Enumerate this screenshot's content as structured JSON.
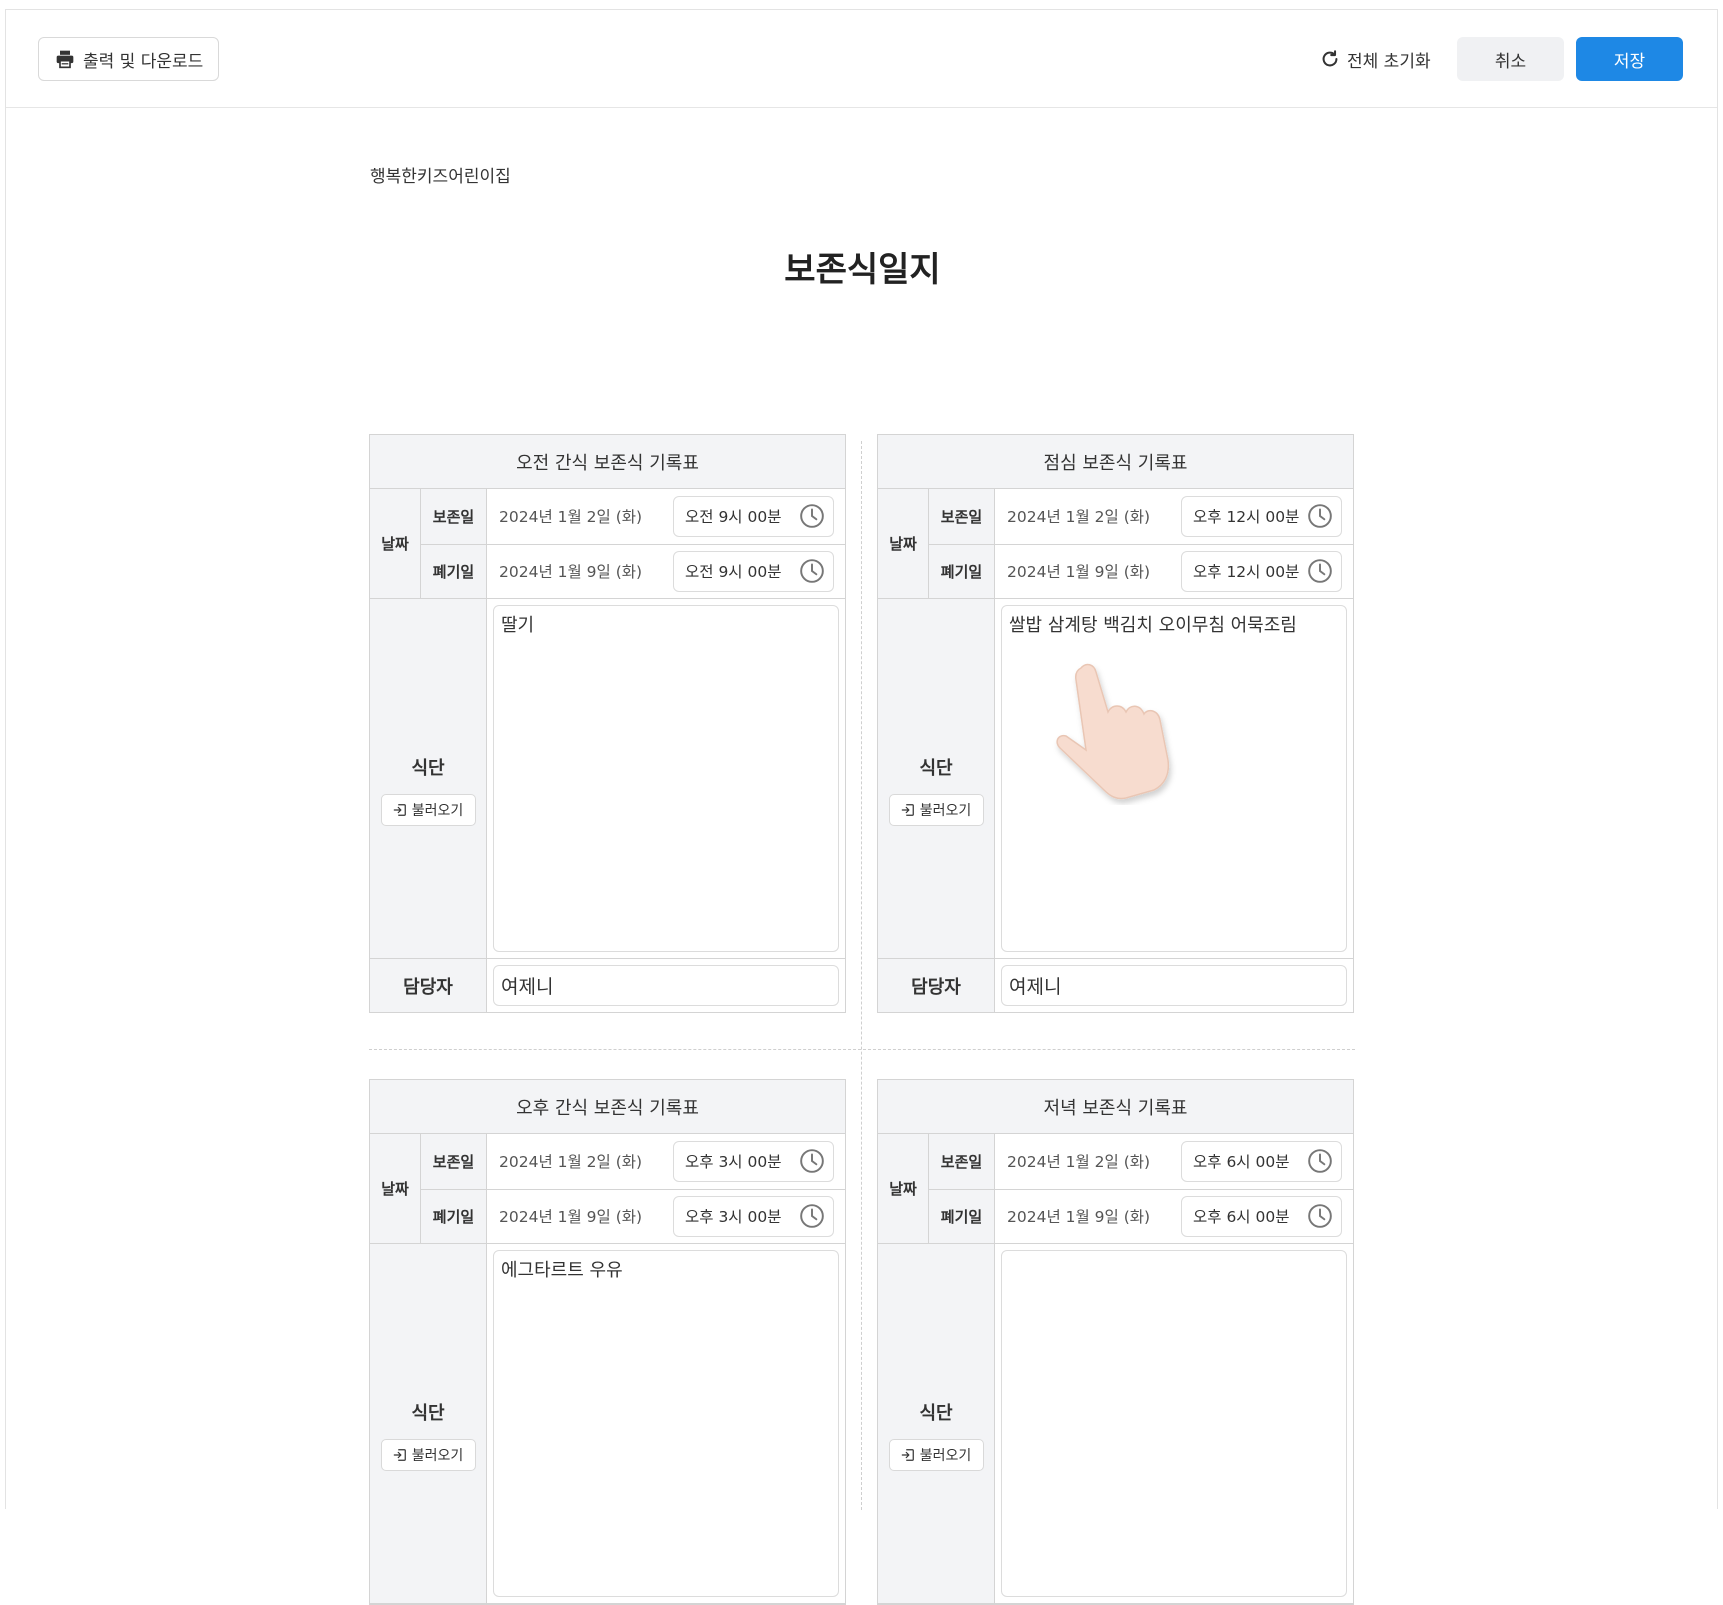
{
  "toolbar": {
    "print_label": "출력 및 다운로드",
    "reset_label": "전체 초기화",
    "cancel_label": "취소",
    "save_label": "저장"
  },
  "document": {
    "org_name": "행복한키즈어린이집",
    "title": "보존식일지"
  },
  "labels": {
    "date": "날짜",
    "keep_day": "보존일",
    "discard_day": "폐기일",
    "menu": "식단",
    "load": "불러오기",
    "staff": "담당자"
  },
  "cards": [
    {
      "title": "오전 간식 보존식 기록표",
      "keep_date": "2024년 1월 2일 (화)",
      "keep_time": "오전 9시 00분",
      "discard_date": "2024년 1월 9일 (화)",
      "discard_time": "오전 9시 00분",
      "menu": "딸기",
      "staff": "여제니"
    },
    {
      "title": "점심 보존식 기록표",
      "keep_date": "2024년 1월 2일 (화)",
      "keep_time": "오후 12시 00분",
      "discard_date": "2024년 1월 9일 (화)",
      "discard_time": "오후 12시 00분",
      "menu": "쌀밥 삼계탕 백김치 오이무침 어묵조림",
      "staff": "여제니"
    },
    {
      "title": "오후 간식 보존식 기록표",
      "keep_date": "2024년 1월 2일 (화)",
      "keep_time": "오후 3시 00분",
      "discard_date": "2024년 1월 9일 (화)",
      "discard_time": "오후 3시 00분",
      "menu": "에그타르트 우유",
      "staff": ""
    },
    {
      "title": "저녁 보존식 기록표",
      "keep_date": "2024년 1월 2일 (화)",
      "keep_time": "오후 6시 00분",
      "discard_date": "2024년 1월 9일 (화)",
      "discard_time": "오후 6시 00분",
      "menu": "",
      "staff": ""
    }
  ],
  "colors": {
    "primary": "#1e88e5",
    "header_bg": "#f3f4f6",
    "border": "#d4d4d4"
  }
}
